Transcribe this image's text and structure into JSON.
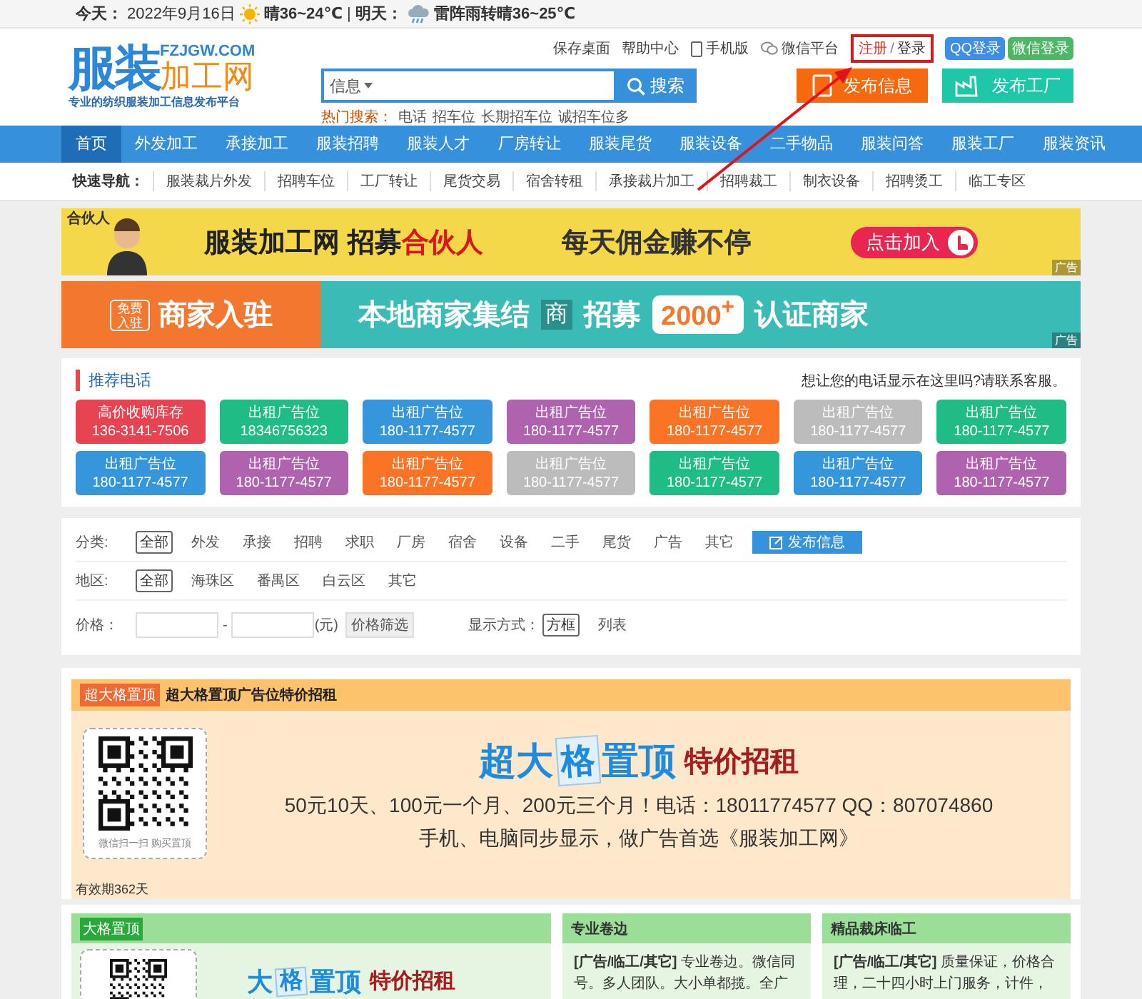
{
  "top_bar": {
    "today_label": "今天：",
    "today_date": "2022年9月16日",
    "today_weather": "晴36~24℃",
    "separator": "|",
    "tomorrow_label": "明天：",
    "tomorrow_weather": "雷阵雨转晴36~25℃"
  },
  "header": {
    "logo": {
      "main": "服装",
      "sub": "加工网",
      "domain": "FZJGW.COM",
      "slogan": "专业的纺织服装加工信息发布平台"
    },
    "links": [
      {
        "text": "保存桌面",
        "kind": "plain"
      },
      {
        "text": "帮助中心",
        "kind": "plain"
      },
      {
        "text": "手机版",
        "kind": "phone"
      },
      {
        "text": "微信平台",
        "kind": "wechat"
      }
    ],
    "account": {
      "register": "注册",
      "separator": "/",
      "login": "登录",
      "highlighted": true
    },
    "social": [
      {
        "label": "QQ登录",
        "color": "#3d8ee8"
      },
      {
        "label": "微信登录",
        "color": "#4cb866"
      }
    ],
    "search": {
      "category": "信息",
      "button": "搜索",
      "hot_label": "热门搜索：",
      "hot_terms": [
        "电话",
        "招车位",
        "长期招车位",
        "诚招车位多"
      ]
    },
    "actions": [
      {
        "label": "发布信息",
        "kind": "document",
        "color": "#f7690f"
      },
      {
        "label": "发布工厂",
        "kind": "factory",
        "color": "#1dc7a8"
      }
    ]
  },
  "nav": [
    {
      "label": "首页",
      "selected": true
    },
    {
      "label": "外发加工",
      "selected": false
    },
    {
      "label": "承接加工",
      "selected": false
    },
    {
      "label": "服装招聘",
      "selected": false
    },
    {
      "label": "服装人才",
      "selected": false
    },
    {
      "label": "厂房转让",
      "selected": false
    },
    {
      "label": "服装尾货",
      "selected": false
    },
    {
      "label": "服装设备",
      "selected": false
    },
    {
      "label": "二手物品",
      "selected": false
    },
    {
      "label": "服装问答",
      "selected": false
    },
    {
      "label": "服装工厂",
      "selected": false
    },
    {
      "label": "服装资讯",
      "selected": false
    }
  ],
  "quick_nav": {
    "label": "快速导航：",
    "items": [
      "服装裁片外发",
      "招聘车位",
      "工厂转让",
      "尾货交易",
      "宿舍转租",
      "承接裁片加工",
      "招聘裁工",
      "制衣设备",
      "招聘烫工",
      "临工专区"
    ]
  },
  "banners": [
    {
      "kind": "recruit",
      "badge": "合伙人",
      "title": "服装加工网 招募",
      "highlight": "合伙人",
      "slogan": "每天佣金赚不停",
      "button": "点击加入",
      "ad_label": "广告"
    },
    {
      "kind": "merchant",
      "badge": "免费入驻",
      "title": "商家入驻",
      "text_1": "本地商家集结",
      "tile": "商",
      "text_2": "招募",
      "count": "2000$^{+}$",
      "text_3": "认证商家",
      "ad_label": "广告"
    }
  ],
  "phones": {
    "title": "推荐电话",
    "note": "想让您的电话显示在这里吗?请联系客服。",
    "items": [
      {
        "name": "高价收购库存",
        "phone": "136-3141-7506",
        "color": "#e84351"
      },
      {
        "name": "出租广告位",
        "phone": "18346756323",
        "color": "#20bc86"
      },
      {
        "name": "出租广告位",
        "phone": "180-1177-4577",
        "color": "#3596dc"
      },
      {
        "name": "出租广告位",
        "phone": "180-1177-4577",
        "color": "#af63ae"
      },
      {
        "name": "出租广告位",
        "phone": "180-1177-4577",
        "color": "#fb7426"
      },
      {
        "name": "出租广告位",
        "phone": "180-1177-4577",
        "color": "#bcbcbc"
      },
      {
        "name": "出租广告位",
        "phone": "180-1177-4577",
        "color": "#20bc86"
      },
      {
        "name": "出租广告位",
        "phone": "180-1177-4577",
        "color": "#3596dc"
      },
      {
        "name": "出租广告位",
        "phone": "180-1177-4577",
        "color": "#af63ae"
      },
      {
        "name": "出租广告位",
        "phone": "180-1177-4577",
        "color": "#fb7426"
      },
      {
        "name": "出租广告位",
        "phone": "180-1177-4577",
        "color": "#bcbcbc"
      },
      {
        "name": "出租广告位",
        "phone": "180-1177-4577",
        "color": "#20bc86"
      },
      {
        "name": "出租广告位",
        "phone": "180-1177-4577",
        "color": "#3596dc"
      },
      {
        "name": "出租广告位",
        "phone": "180-1177-4577",
        "color": "#af63ae"
      }
    ]
  },
  "filters": {
    "category": {
      "label": "分类:",
      "options": [
        {
          "label": "全部",
          "selected": true
        },
        {
          "label": "外发",
          "selected": false
        },
        {
          "label": "承接",
          "selected": false
        },
        {
          "label": "招聘",
          "selected": false
        },
        {
          "label": "求职",
          "selected": false
        },
        {
          "label": "厂房",
          "selected": false
        },
        {
          "label": "宿舍",
          "selected": false
        },
        {
          "label": "设备",
          "selected": false
        },
        {
          "label": "二手",
          "selected": false
        },
        {
          "label": "尾货",
          "selected": false
        },
        {
          "label": "广告",
          "selected": false
        },
        {
          "label": "其它",
          "selected": false
        }
      ],
      "publish_button": "发布信息"
    },
    "region": {
      "label": "地区:",
      "options": [
        {
          "label": "全部",
          "selected": true
        },
        {
          "label": "海珠区",
          "selected": false
        },
        {
          "label": "番禺区",
          "selected": false
        },
        {
          "label": "白云区",
          "selected": false
        },
        {
          "label": "其它",
          "selected": false
        }
      ]
    },
    "price": {
      "label": "价格：",
      "separator": "-",
      "unit": "(元)",
      "button": "价格筛选"
    },
    "display": {
      "label": "显示方式：",
      "options": [
        {
          "label": "方框",
          "selected": true
        },
        {
          "label": "列表",
          "selected": false
        }
      ]
    }
  },
  "featured": {
    "badge": "超大格置顶",
    "title": "超大格置顶广告位特价招租",
    "qr_caption": "微信扫一扫 购买置顶",
    "headline": {
      "part_1": "超大",
      "tile": "格",
      "part_2": "置顶",
      "suffix": "特价招租"
    },
    "lines": [
      "50元10天、100元一个月、200元三个月！电话：18011774577 QQ：807074860",
      "手机、电脑同步显示，做广告首选《服装加工网》"
    ],
    "validity": "有效期362天"
  },
  "bottom": {
    "big": {
      "badge": "大格置顶",
      "headline": {
        "part_1": "大",
        "tile": "格",
        "part_2": "置顶",
        "suffix": "特价招租"
      }
    },
    "cards": [
      {
        "title": "专业卷边",
        "tag": "[广告/临工/其它]",
        "text": "专业卷边。微信同号。多人团队。大小单都揽。全广"
      },
      {
        "title": "精品裁床临工",
        "tag": "[广告/临工/其它]",
        "text": "质量保证，价格合理，二十四小时上门服务，计件，"
      }
    ]
  }
}
